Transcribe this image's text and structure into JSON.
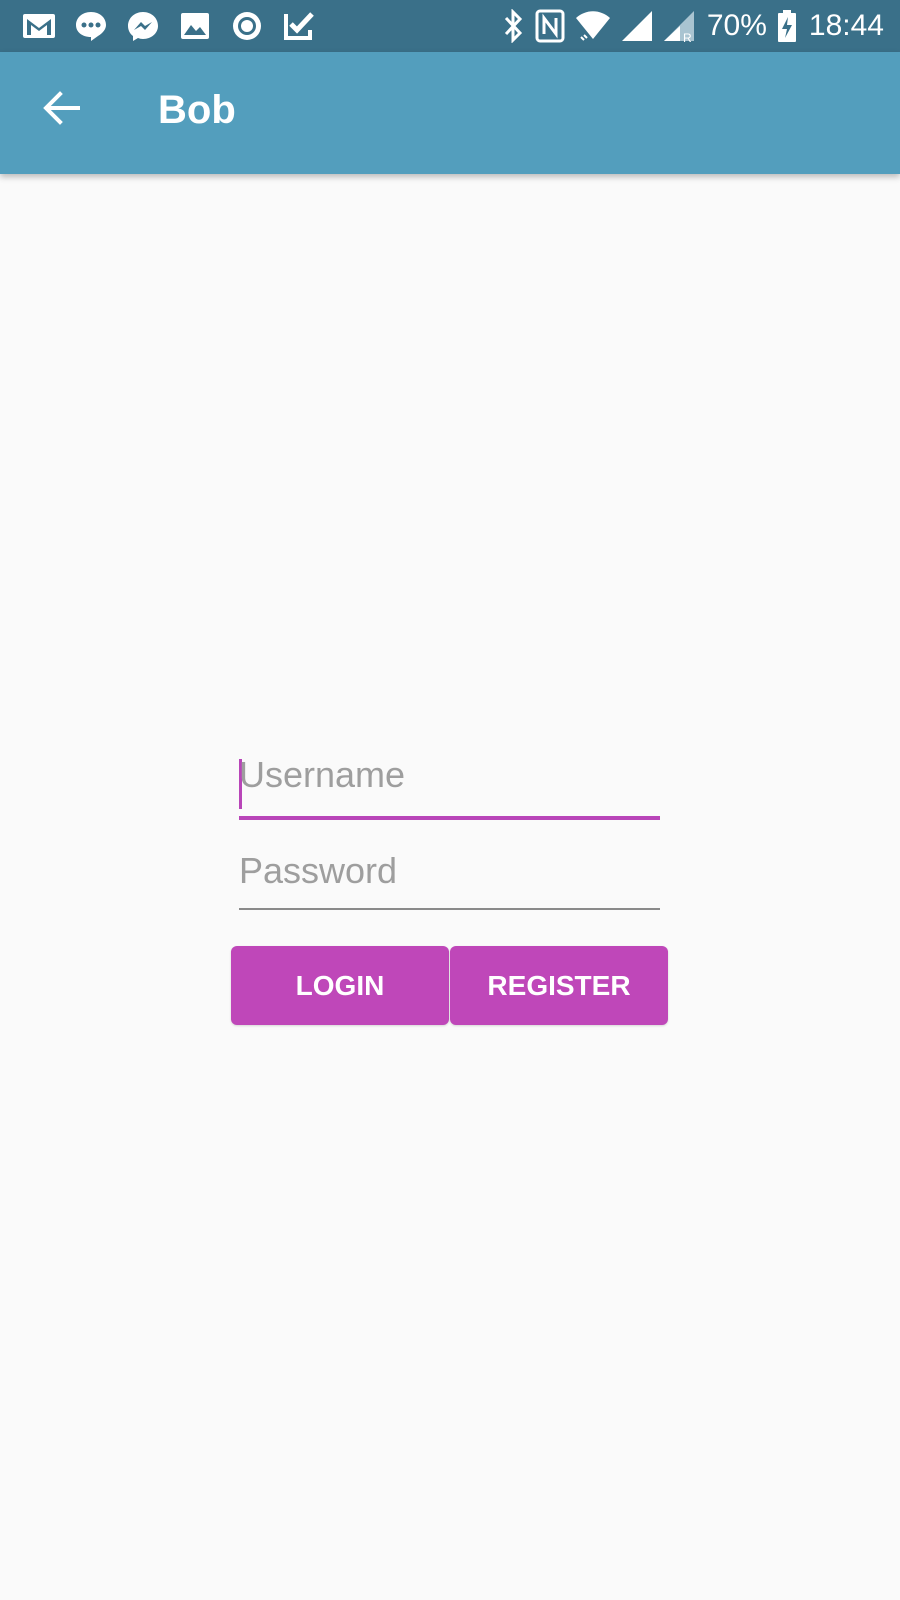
{
  "status_bar": {
    "battery_percent": "70%",
    "time": "18:44",
    "left_icons": [
      "gmail-icon",
      "messages-icon",
      "messenger-icon",
      "gallery-icon",
      "record-icon",
      "tasks-icon"
    ],
    "right_icons": [
      "bluetooth-icon",
      "nfc-icon",
      "wifi-icon",
      "signal-icon",
      "roaming-signal-icon",
      "battery-charging-icon"
    ]
  },
  "app_bar": {
    "title": "Bob",
    "back_icon": "arrow-back-icon"
  },
  "form": {
    "username": {
      "placeholder": "Username",
      "value": ""
    },
    "password": {
      "placeholder": "Password",
      "value": ""
    },
    "login_label": "LOGIN",
    "register_label": "REGISTER"
  },
  "colors": {
    "status_bar": "#3a7089",
    "app_bar": "#539ebd",
    "accent": "#bf47b9",
    "background": "#fafafa"
  }
}
